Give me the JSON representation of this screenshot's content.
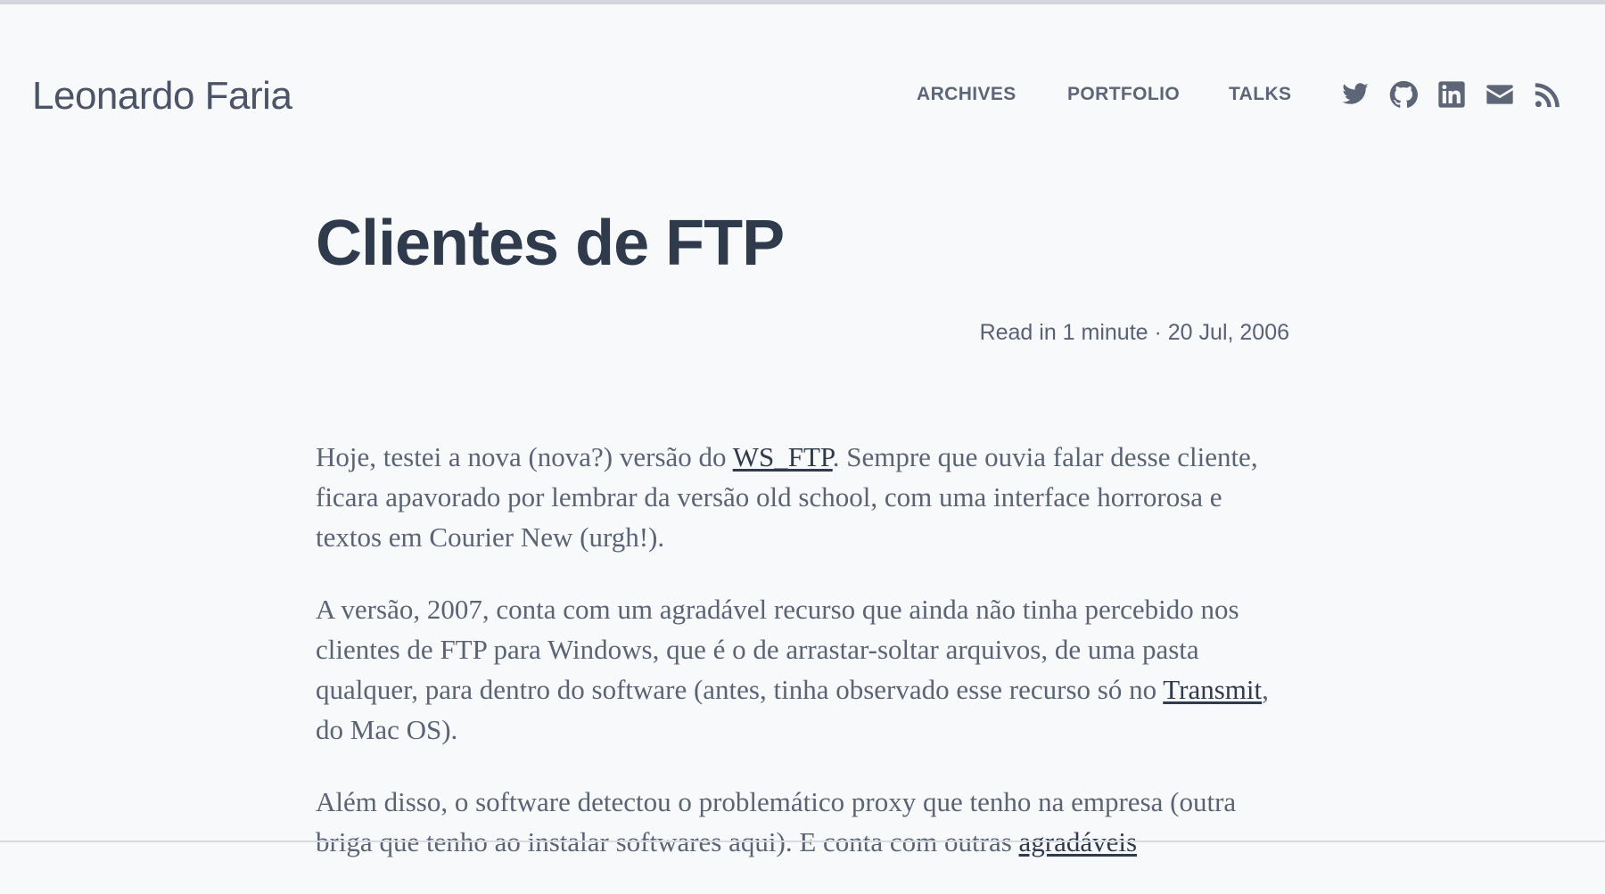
{
  "site": {
    "title": "Leonardo Faria"
  },
  "nav": {
    "items": [
      {
        "label": "ARCHIVES"
      },
      {
        "label": "PORTFOLIO"
      },
      {
        "label": "TALKS"
      }
    ]
  },
  "social": [
    {
      "icon": "twitter-icon"
    },
    {
      "icon": "github-icon"
    },
    {
      "icon": "linkedin-icon"
    },
    {
      "icon": "email-icon"
    },
    {
      "icon": "rss-icon"
    }
  ],
  "post": {
    "title": "Clientes de FTP",
    "meta": "Read in 1 minute · 20 Jul, 2006",
    "p1": {
      "before": "Hoje, testei a nova (nova?) versão do ",
      "link": "WS_FTP",
      "after": ". Sempre que ouvia falar desse cliente, ficara apavorado por lembrar da versão old school, com uma interface horrorosa e textos em Courier New (urgh!)."
    },
    "p2": {
      "before": "A versão, 2007, conta com um agradável recurso que ainda não tinha percebido nos clientes de FTP para Windows, que é o de arrastar-soltar arquivos, de uma pasta qualquer, para dentro do software (antes, tinha observado esse recurso só no ",
      "link": "Transmit",
      "after": ", do Mac OS)."
    },
    "p3": {
      "before": "Além disso, o software detectou o problemático proxy que tenho na empresa (outra briga que tenho ao instalar softwares aqui). E conta com outras ",
      "link": "agradáveis"
    }
  },
  "colors": {
    "background": "#f8f9fb",
    "title": "#2f3a4c",
    "nav": "#5d6677",
    "body_text": "#5b6474",
    "link": "#2f3a4c"
  }
}
